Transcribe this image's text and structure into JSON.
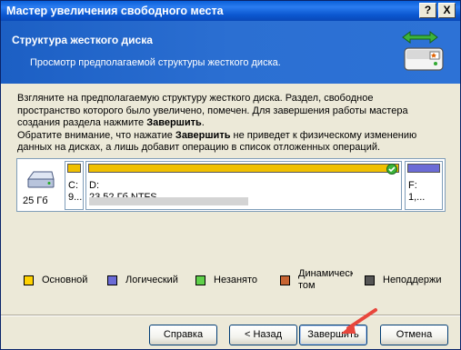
{
  "window": {
    "title": "Мастер увеличения свободного места",
    "help_btn": "?",
    "close_btn": "X"
  },
  "header": {
    "title": "Структура жесткого диска",
    "subtitle": "Просмотр предполагаемой структуры жесткого диска."
  },
  "intro": {
    "line1": "Взгляните на предполагаемую структуру жесткого диска. Раздел, свободное",
    "line2": "пространство которого было увеличено, помечен. Для завершения работы мастера",
    "line3a": "создания раздела нажмите ",
    "line3b": "Завершить",
    "line3c": ".",
    "line4a": "Обратите внимание, что нажатие ",
    "line4b": "Завершить",
    "line4c": " не приведет к физическому изменению",
    "line5": "данных на дисках, а лишь добавит операцию в список отложенных операций."
  },
  "disk": {
    "size": "25 Гб",
    "partitions": [
      {
        "line1": "C:",
        "line2": "9...",
        "color": "#f0c000"
      },
      {
        "line1": "D:",
        "line2": "23,52 Гб  NTFS",
        "color": "#f0c000"
      },
      {
        "line1": "F:",
        "line2": "1,...",
        "color": "#6b6bd6"
      }
    ]
  },
  "legend": [
    {
      "label": "Основной",
      "color": "#ffd200"
    },
    {
      "label": "Логический",
      "color": "#6b6bd6"
    },
    {
      "label": "Незанято",
      "color": "#5fd04a"
    },
    {
      "label": "Динамическ\nтом",
      "color": "#c86432"
    },
    {
      "label": "Неподдержи",
      "color": "#555555"
    }
  ],
  "buttons": {
    "help": "Справка",
    "back": "< Назад",
    "finish": "Завершить",
    "cancel": "Отмена"
  }
}
